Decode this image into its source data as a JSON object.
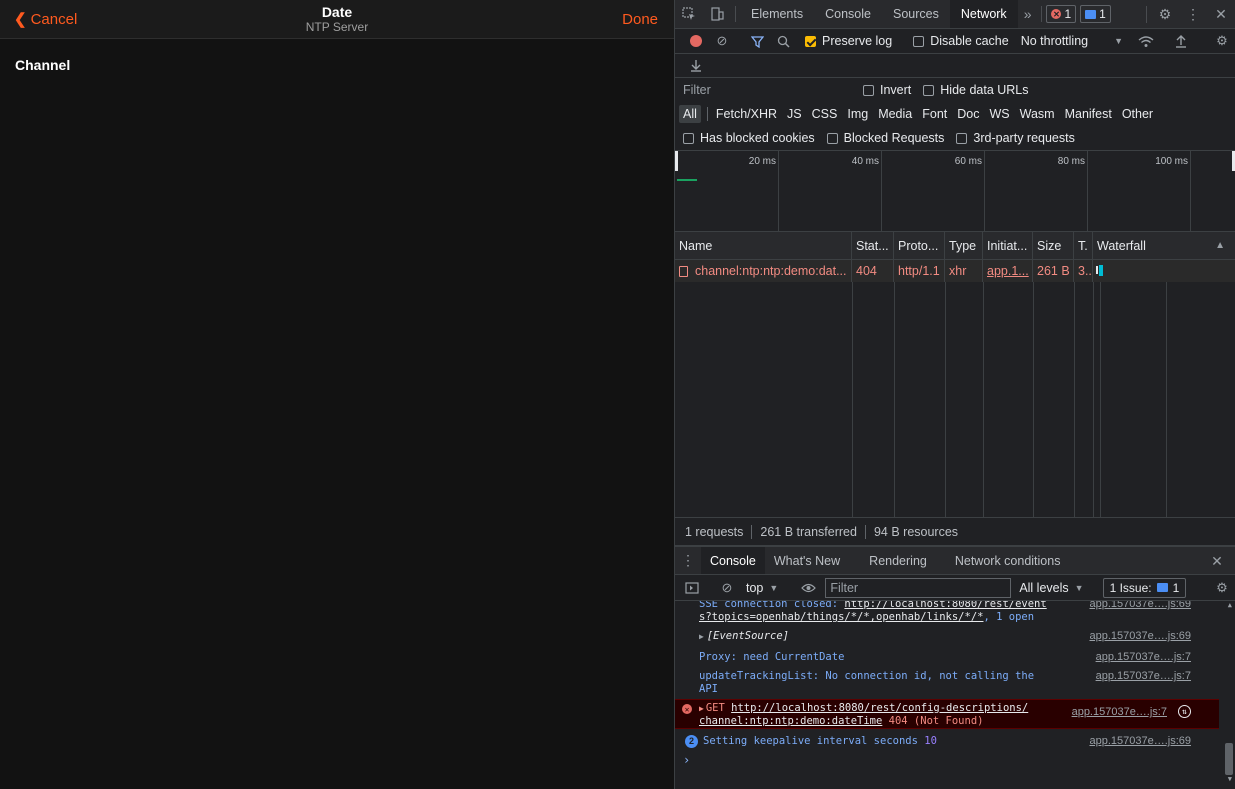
{
  "app": {
    "cancel_label": "Cancel",
    "title": "Date",
    "subtitle": "NTP Server",
    "done_label": "Done",
    "section": "Channel"
  },
  "devtools": {
    "tabs": [
      "Elements",
      "Console",
      "Sources",
      "Network"
    ],
    "active_tab": "Network",
    "errors_count": "1",
    "messages_count": "1",
    "toolbar": {
      "preserve_log": "Preserve log",
      "disable_cache": "Disable cache",
      "throttling": "No throttling"
    },
    "filter": {
      "placeholder": "Filter",
      "invert": "Invert",
      "hide_data_urls": "Hide data URLs"
    },
    "types": [
      "All",
      "Fetch/XHR",
      "JS",
      "CSS",
      "Img",
      "Media",
      "Font",
      "Doc",
      "WS",
      "Wasm",
      "Manifest",
      "Other"
    ],
    "blocked": {
      "has_blocked_cookies": "Has blocked cookies",
      "blocked_requests": "Blocked Requests",
      "third_party": "3rd-party requests"
    },
    "overview_ticks": [
      "20 ms",
      "40 ms",
      "60 ms",
      "80 ms",
      "100 ms"
    ],
    "table": {
      "headers": [
        "Name",
        "Stat...",
        "Proto...",
        "Type",
        "Initiat...",
        "Size",
        "T.",
        "Waterfall"
      ],
      "rows": [
        {
          "name": "channel:ntp:ntp:demo:dat...",
          "status": "404",
          "protocol": "http/1.1",
          "type": "xhr",
          "initiator": "app.1...",
          "size": "261 B",
          "time": "3..."
        }
      ]
    },
    "summary": {
      "requests": "1 requests",
      "transferred": "261 B transferred",
      "resources": "94 B resources"
    },
    "drawer_tabs": [
      "Console",
      "What's New",
      "Rendering",
      "Network conditions"
    ],
    "console_toolbar": {
      "context": "top",
      "filter_placeholder": "Filter",
      "levels": "All levels",
      "issues_label": "1 Issue:",
      "issues_count": "1"
    },
    "console": {
      "line1_a": "SSE connection closed: ",
      "line1_url_a": "http://localhost:8080/rest/event",
      "line1_url_b": "s?topics=openhab/things/*/*,openhab/links/*/*",
      "line1_suffix": ", 1 open",
      "line1_src": "app.157037e….js:69",
      "line2": "[EventSource]",
      "line2_src": "app.157037e….js:69",
      "line3": "Proxy: need CurrentDate",
      "line3_src": "app.157037e….js:7",
      "line4_a": "updateTrackingList: No connection id, not calling the",
      "line4_b": "API",
      "line4_src": "app.157037e….js:7",
      "line5_method": "GET ",
      "line5_url_a": "http://localhost:8080/rest/config-descriptions/",
      "line5_url_b": "channel:ntp:ntp:demo:dateTime",
      "line5_status": " 404 (Not Found)",
      "line5_src": "app.157037e….js:7",
      "line6_count": "2",
      "line6_text": "Setting keepalive interval seconds ",
      "line6_value": "10",
      "line6_src": "app.157037e….js:69"
    }
  }
}
